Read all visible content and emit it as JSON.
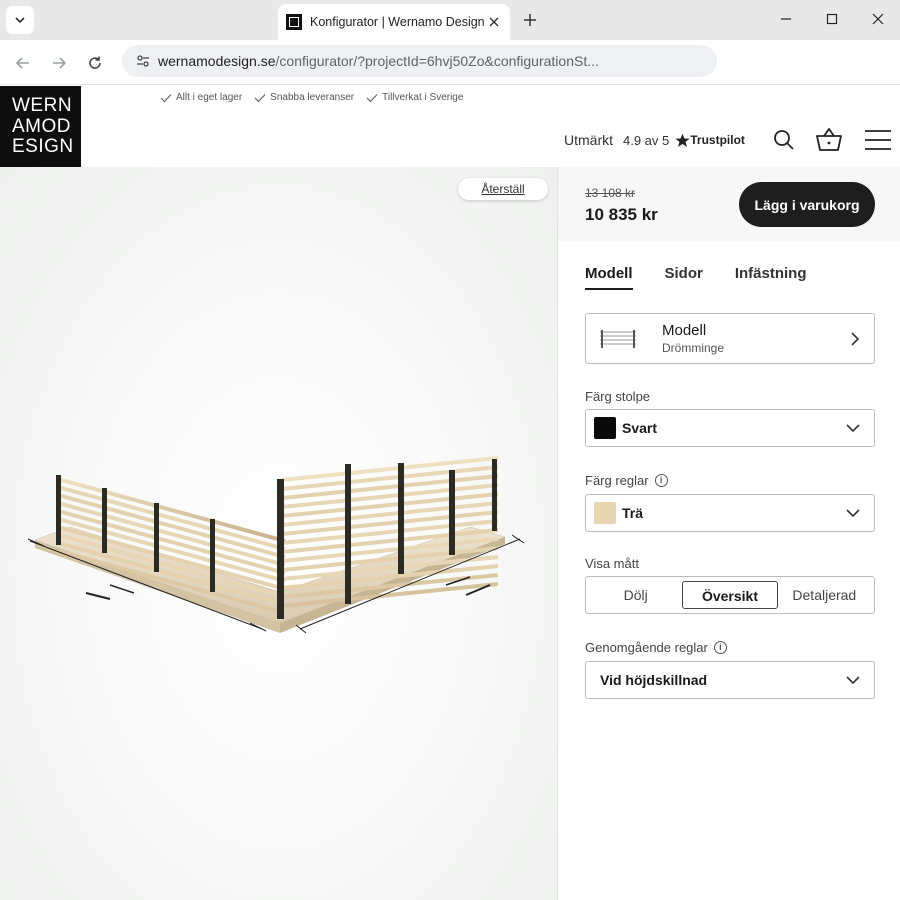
{
  "browser": {
    "tab_title": "Konfigurator | Wernamo Design",
    "url_host": "wernamodesign.se",
    "url_path": "/configurator/?projectId=6hvj50Zo&configurationSt..."
  },
  "site": {
    "logo_lines": [
      "WERN",
      "AMOD",
      "ESIGN"
    ],
    "usps": [
      "Allt i eget lager",
      "Snabba leveranser",
      "Tillverkat i Sverige"
    ],
    "trust_label": "Utmärkt",
    "trust_rating": "4.9 av 5",
    "trust_brand": "Trustpilot"
  },
  "viewer": {
    "reset_label": "Återställ"
  },
  "panel": {
    "old_price": "13 108 kr",
    "price": "10 835 kr",
    "cart_label": "Lägg i varukorg",
    "tabs": [
      {
        "label": "Modell",
        "active": true
      },
      {
        "label": "Sidor",
        "active": false
      },
      {
        "label": "Infästning",
        "active": false
      }
    ],
    "model": {
      "title": "Modell",
      "value": "Drömminge"
    },
    "post_color": {
      "label": "Färg stolpe",
      "value": "Svart",
      "swatch": "#0a0a0a"
    },
    "rail_color": {
      "label": "Färg reglar",
      "value": "Trä",
      "swatch": "#e8d6b2"
    },
    "dimensions": {
      "label": "Visa mått",
      "options": [
        "Dölj",
        "Översikt",
        "Detaljerad"
      ],
      "selected": "Översikt"
    },
    "through_rails": {
      "label": "Genomgående reglar",
      "value": "Vid höjdskillnad"
    }
  }
}
